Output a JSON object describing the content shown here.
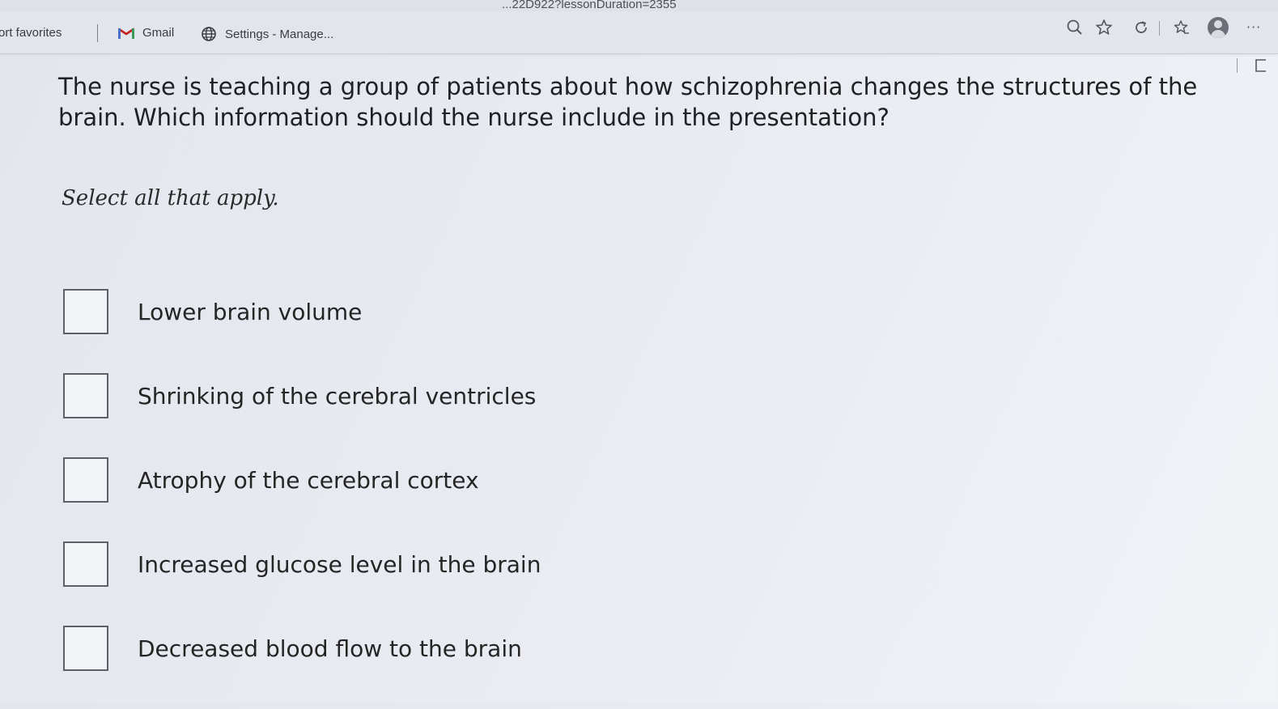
{
  "browser": {
    "url_fragment": "...22D922?lessonDuration=2355",
    "bookmarks": {
      "favorites_label": "ort favorites",
      "gmail_label": "Gmail",
      "settings_label": "Settings - Manage..."
    },
    "more_label": "···"
  },
  "question": {
    "text": "The nurse is teaching a group of patients about how schizophrenia changes the structures of the brain. Which information should the nurse include in the presentation?",
    "instruction": "Select all that apply."
  },
  "options": [
    {
      "label": "Lower brain volume",
      "checked": false
    },
    {
      "label": "Shrinking of the cerebral ventricles",
      "checked": false
    },
    {
      "label": "Atrophy of the cerebral cortex",
      "checked": false
    },
    {
      "label": "Increased glucose level in the brain",
      "checked": false
    },
    {
      "label": "Decreased blood flow to the brain",
      "checked": false
    }
  ],
  "icons": {
    "gmail": "gmail-icon",
    "settings": "globe-icon",
    "zoom": "zoom-icon",
    "favorite": "star-icon",
    "refresh": "refresh-icon",
    "favorites_bar": "favorites-icon",
    "profile": "avatar",
    "more": "more-icon"
  },
  "colors": {
    "checkbox_border": "#5f6168",
    "text": "#202124",
    "gmail_red": "#c5221f"
  }
}
